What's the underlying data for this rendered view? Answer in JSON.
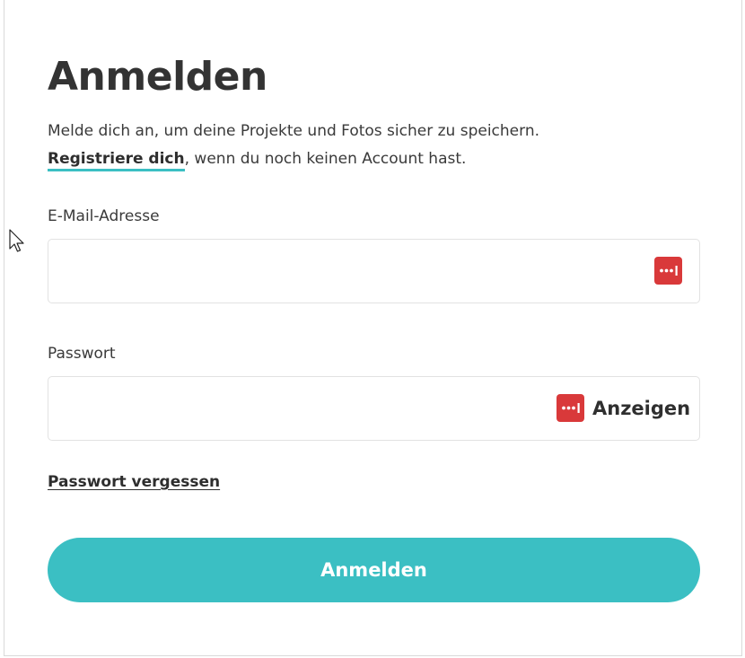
{
  "page": {
    "title": "Anmelden",
    "intro_text": "Melde dich an, um deine Projekte und Fotos sicher zu speichern.",
    "register_link": "Registriere dich",
    "register_suffix": ", wenn du noch keinen Account hast."
  },
  "form": {
    "email": {
      "label": "E-Mail-Adresse",
      "value": "",
      "placeholder": ""
    },
    "password": {
      "label": "Passwort",
      "value": "",
      "placeholder": "",
      "show_label": "Anzeigen"
    },
    "forgot_password": "Passwort vergessen",
    "submit_label": "Anmelden"
  },
  "icons": {
    "password_manager": "password-manager-icon",
    "cursor": "mouse-pointer-icon"
  },
  "colors": {
    "accent": "#3bbfc3",
    "password_manager": "#d9393a",
    "text": "#333333"
  }
}
